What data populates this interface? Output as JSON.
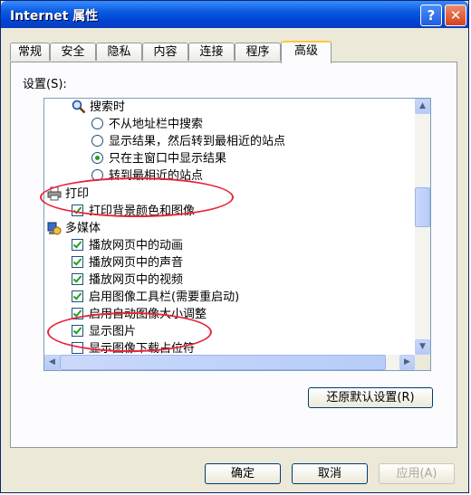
{
  "window": {
    "title": "Internet 属性"
  },
  "tabs": [
    {
      "label": "常规"
    },
    {
      "label": "安全"
    },
    {
      "label": "隐私"
    },
    {
      "label": "内容"
    },
    {
      "label": "连接"
    },
    {
      "label": "程序"
    },
    {
      "label": "高级"
    }
  ],
  "settings_label": "设置(S):",
  "list": {
    "search_group": "搜索时",
    "search_options": [
      {
        "label": "不从地址栏中搜索",
        "checked": false
      },
      {
        "label": "显示结果，然后转到最相近的站点",
        "checked": false
      },
      {
        "label": "只在主窗口中显示结果",
        "checked": true
      },
      {
        "label": "转到最相近的站点",
        "checked": false
      }
    ],
    "print_group": "打印",
    "print_options": [
      {
        "label": "打印背景颜色和图像",
        "checked": true
      }
    ],
    "multimedia_group": "多媒体",
    "multimedia_options": [
      {
        "label": "播放网页中的动画",
        "checked": true
      },
      {
        "label": "播放网页中的声音",
        "checked": true
      },
      {
        "label": "播放网页中的视频",
        "checked": true
      },
      {
        "label": "启用图像工具栏(需要重启动)",
        "checked": true
      },
      {
        "label": "启用自动图像大小调整",
        "checked": true
      },
      {
        "label": "显示图片",
        "checked": true
      },
      {
        "label": "显示图像下载占位符",
        "checked": false
      }
    ]
  },
  "buttons": {
    "restore": "还原默认设置(R)",
    "ok": "确定",
    "cancel": "取消",
    "apply": "应用(A)"
  },
  "colors": {
    "annotation": "#e8253b",
    "check": "#21a121",
    "titlebar": "#0046d5"
  }
}
